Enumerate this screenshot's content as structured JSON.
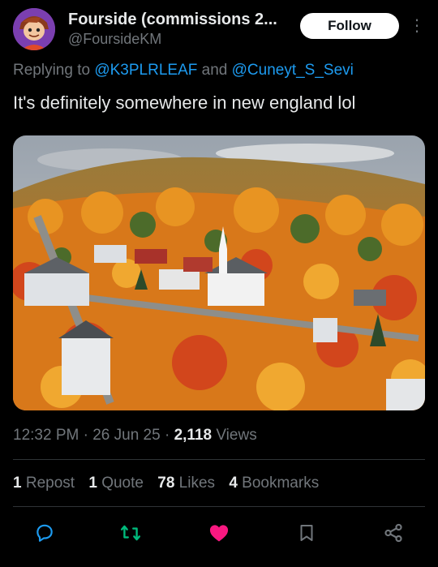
{
  "author": {
    "display_name": "Fourside (commissions 2...",
    "handle": "@FoursideKM",
    "follow_label": "Follow",
    "more_label": "⋮"
  },
  "reply": {
    "prefix": "Replying to ",
    "mention1": "@K3PLRLEAF",
    "joiner": " and ",
    "mention2": "@Cuneyt_S_Sevi"
  },
  "post": {
    "text": "It's definitely somewhere in new england lol",
    "photo_icon": "autumn-village-aerial-photo"
  },
  "meta": {
    "time": "12:32 PM",
    "sep": " · ",
    "date": "26 Jun 25",
    "views_count": "2,118",
    "views_label": " Views"
  },
  "stats": {
    "reposts_count": "1",
    "reposts_label": " Repost",
    "quotes_count": "1",
    "quotes_label": " Quote",
    "likes_count": "78",
    "likes_label": " Likes",
    "bookmarks_count": "4",
    "bookmarks_label": " Bookmarks"
  },
  "actions": {
    "reply_icon": "reply-icon",
    "repost_icon": "repost-icon",
    "like_icon": "like-icon",
    "bookmark_icon": "bookmark-icon",
    "share_icon": "share-icon"
  },
  "colors": {
    "background": "#000000",
    "accent": "#1d9bf0",
    "repost": "#00ba7c",
    "like": "#f91880",
    "muted": "#71767b"
  }
}
